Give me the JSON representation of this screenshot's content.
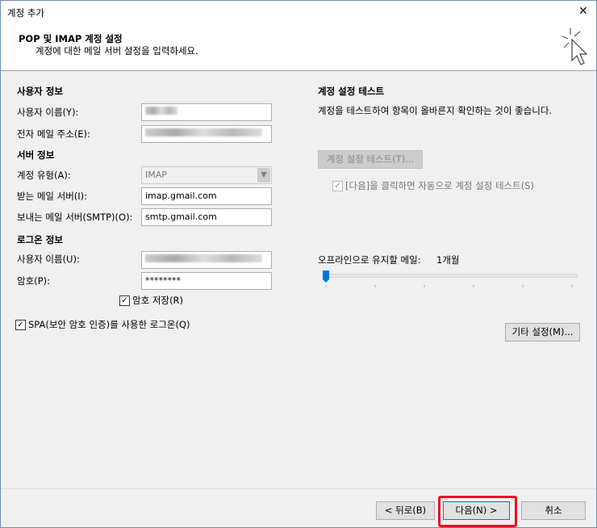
{
  "window": {
    "title": "계정 추가",
    "close": "✕"
  },
  "header": {
    "title": "POP 및 IMAP 계정 설정",
    "subtitle": "계정에 대한 메일 서버 설정을 입력하세요."
  },
  "user_info": {
    "heading": "사용자 정보",
    "name_label": "사용자 이름(Y):",
    "email_label": "전자 메일 주소(E):"
  },
  "server_info": {
    "heading": "서버 정보",
    "type_label": "계정 유형(A):",
    "type_value": "IMAP",
    "incoming_label": "받는 메일 서버(I):",
    "incoming_value": "imap.gmail.com",
    "outgoing_label": "보내는 메일 서버(SMTP)(O):",
    "outgoing_value": "smtp.gmail.com"
  },
  "login_info": {
    "heading": "로그온 정보",
    "user_label": "사용자 이름(U):",
    "password_label": "암호(P):",
    "password_value": "********",
    "remember_label": "암호 저장(R)",
    "remember_checked": true,
    "spa_label": "SPA(보안 암호 인증)를 사용한 로그온(Q)",
    "spa_checked": true
  },
  "test": {
    "heading": "계정 설정 테스트",
    "description": "계정을 테스트하여 항목이 올바른지 확인하는 것이 좋습니다.",
    "button": "계정 설정 테스트(T)...",
    "auto_label": "[다음]을 클릭하면 자동으로 계정 설정 테스트(S)",
    "auto_checked": true
  },
  "offline": {
    "label": "오프라인으로 유지할 메일:",
    "value": "1개월",
    "slider_position": 0
  },
  "more_settings": "기타 설정(M)...",
  "footer": {
    "back": "< 뒤로(B)",
    "next": "다음(N) >",
    "cancel": "취소"
  },
  "colors": {
    "highlight": "#e81123",
    "slider": "#0078d7"
  }
}
